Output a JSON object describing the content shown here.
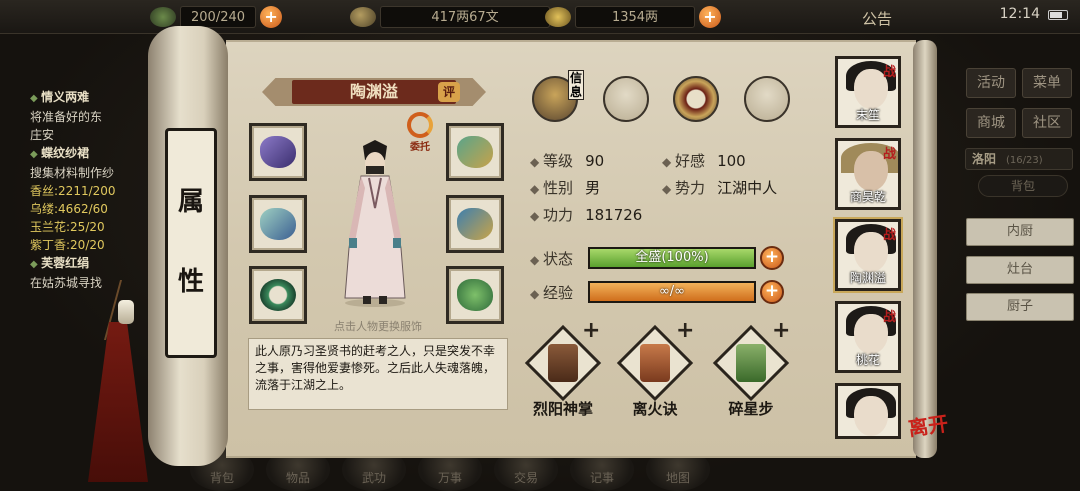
{
  "topbar": {
    "stamina": "200/240",
    "money": "417两67文",
    "gold": "1354两",
    "notice": "公告",
    "clock": "12:14"
  },
  "quests": [
    {
      "title": "情义两难",
      "lines": [
        "将准备好的东",
        "庄安"
      ]
    },
    {
      "title": "蝶纹纱裙",
      "lines": [
        "搜集材料制作纱"
      ]
    },
    {
      "materials": [
        "香丝:2211/200",
        "乌缕:4662/60",
        "玉兰花:25/20",
        "紫丁香:20/20"
      ]
    },
    {
      "title": "芙蓉红绢",
      "lines": [
        "在姑苏城寻找"
      ]
    }
  ],
  "sidemenu": {
    "buttons": [
      "活动",
      "菜单",
      "商城",
      "社区"
    ],
    "city": "洛阳",
    "city_count": "(16/23)",
    "bag": "背包",
    "kitchen": [
      "内厨",
      "灶台",
      "厨子"
    ]
  },
  "bottomnav": [
    "背包",
    "物品",
    "武功",
    "万事",
    "交易",
    "记事",
    "地图"
  ],
  "panel": {
    "tab_title": [
      "属",
      "性"
    ],
    "char_name": "陶渊溢",
    "rate_label": "评",
    "trust_label": "委托",
    "change_outfit_hint": "点击人物更换服饰",
    "bio": "此人原乃习圣贤书的赶考之人，只是突发不幸之事，害得他爱妻惨死。之后此人失魂落魄，流落于江湖之上。",
    "info_label": "信息"
  },
  "stats": {
    "level_label": "等级",
    "level": "90",
    "favor_label": "好感",
    "favor": "100",
    "gender_label": "性别",
    "gender": "男",
    "faction_label": "势力",
    "faction": "江湖中人",
    "power_label": "功力",
    "power": "181726"
  },
  "bars": {
    "state_label": "状态",
    "state_text": "全盛(100%)",
    "state_pct": 100,
    "exp_label": "经验",
    "exp_text": "∞/∞",
    "exp_pct": 100
  },
  "skills": [
    "烈阳神掌",
    "离火诀",
    "碎星步"
  ],
  "portraits": [
    {
      "name": "末笙",
      "tag": "战"
    },
    {
      "name": "商昊乾",
      "tag": "战"
    },
    {
      "name": "陶渊溢",
      "tag": "战"
    },
    {
      "name": "桃花",
      "tag": "战"
    },
    {
      "name": "",
      "tag": ""
    }
  ],
  "leave_label": "离开"
}
